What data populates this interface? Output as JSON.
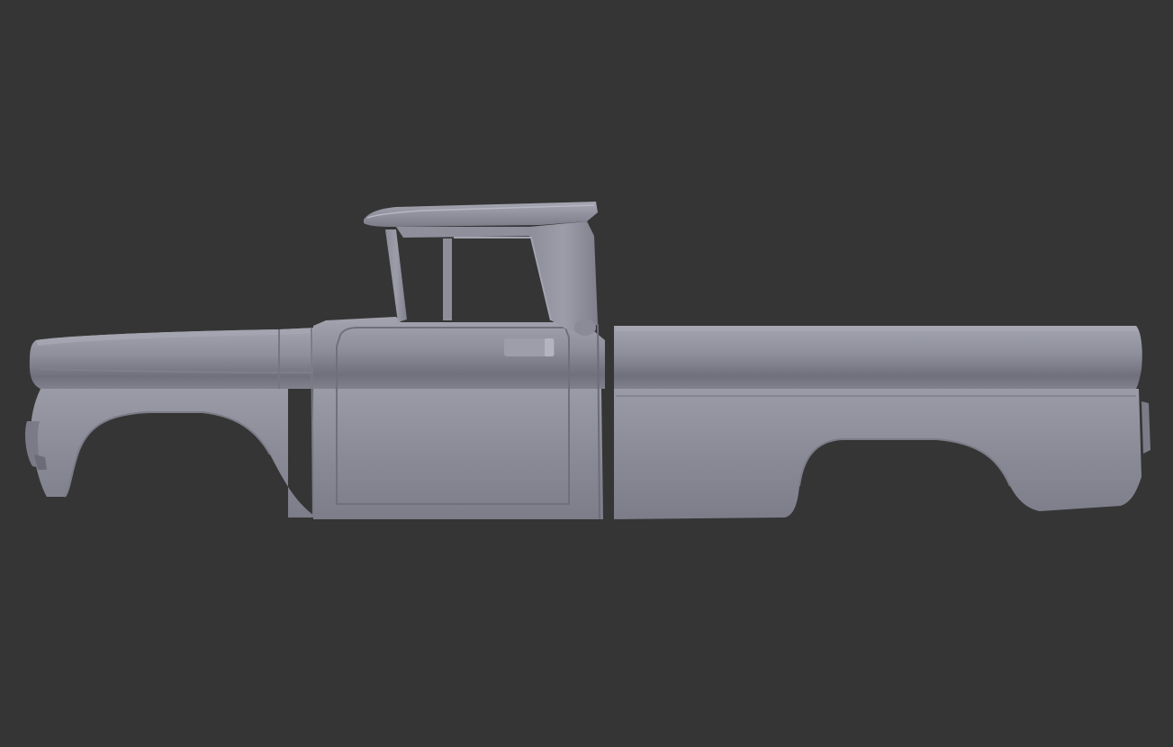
{
  "viewport": {
    "background_color": "#353535",
    "model_base_color": "#8b8c98",
    "model_highlight_color": "#a9aab6",
    "model_shadow_color": "#6a6b77"
  }
}
